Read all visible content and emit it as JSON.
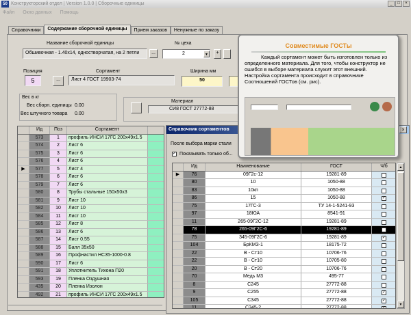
{
  "window": {
    "title": "Конструкторский отдел | Version 1.0.0 | Сборочные единицы",
    "menu": [
      "Файл",
      "Окно данных",
      "Помощь"
    ]
  },
  "tabs": [
    "Справочники",
    "Содержание сборочной единицы",
    "Прием заказов",
    "Ненужные по заказу"
  ],
  "form": {
    "assembly_label": "Название сборочной единицы",
    "assembly_value": "Обшивочная - 1.40x14, одностворчатая, на 2 петли",
    "shop_label": "№ цеха",
    "shop_value": "2",
    "position_label": "Позиция",
    "position_value": "5",
    "sortament_label": "Сортамент",
    "sortament_value": "Лист 4 ГОСТ 19903-74",
    "width_label": "Ширина мм",
    "width_value": "50",
    "weight_group": "Вес в кг",
    "weight_unit_label": "Вес сборн. единицы",
    "weight_unit_value": "0.00",
    "weight_piece_label": "Вес штучного товара",
    "weight_piece_value": "0.00",
    "material_label": "Материал",
    "material_value": "СИ8 ГОСТ 27772-88",
    "browse": "..."
  },
  "left_grid": {
    "headers": [
      "Ид",
      "Поз",
      "Сортамент"
    ],
    "rows": [
      [
        "573",
        "1",
        "профиль ИНСИ 17ГС 200x49x1.5"
      ],
      [
        "574",
        "2",
        "Лист 6"
      ],
      [
        "575",
        "3",
        "Лист 6"
      ],
      [
        "576",
        "4",
        "Лист 6"
      ],
      [
        "577",
        "5",
        "Лист 4"
      ],
      [
        "578",
        "6",
        "Лист 6"
      ],
      [
        "579",
        "7",
        "Лист 6"
      ],
      [
        "580",
        "8",
        "Трубы стальные 150x50x3"
      ],
      [
        "581",
        "9",
        "Лист 10"
      ],
      [
        "582",
        "10",
        "Лист 10"
      ],
      [
        "584",
        "11",
        "Лист 10"
      ],
      [
        "585",
        "12",
        "Лист 8"
      ],
      [
        "586",
        "13",
        "Лист 6"
      ],
      [
        "587",
        "14",
        "Лист 0.55"
      ],
      [
        "588",
        "15",
        "Балл 35x50"
      ],
      [
        "589",
        "16",
        "Профнастил НС35-1000-0.8"
      ],
      [
        "590",
        "17",
        "Лист 6"
      ],
      [
        "591",
        "18",
        "Уплотнитель Тихона П20"
      ],
      [
        "593",
        "19",
        "Пленка Оздушная"
      ],
      [
        "435",
        "20",
        "Пленка Изолон"
      ],
      [
        "492",
        "21",
        "профиль ИНСИ 17ГС 200x49x1.5"
      ]
    ],
    "current_row": 4
  },
  "ref_window": {
    "title": "Справочник сортаментов",
    "hint": "После выбора марки стали",
    "checkbox_label": "Показывать только об...",
    "checkbox_checked": true,
    "headers": [
      "Ид",
      "Наименование",
      "ГОСТ",
      "Ч/б"
    ],
    "rows": [
      [
        "76",
        "09Г2с-12",
        "19281-89",
        false
      ],
      [
        "80",
        "10",
        "1050-88",
        false
      ],
      [
        "83",
        "10кп",
        "1050-88",
        false
      ],
      [
        "86",
        "15",
        "1050-88",
        true
      ],
      [
        "75",
        "17ГС-3",
        "ТУ 14-1-5241-93",
        false
      ],
      [
        "97",
        "18ЮА",
        "8541-91",
        false
      ],
      [
        "11",
        "265-09Г2С-12",
        "19281-89",
        false
      ],
      [
        "78",
        "265-09Г2С-6",
        "19281-89",
        false
      ],
      [
        "75",
        "345-09Г2С-6",
        "19281-89",
        true
      ],
      [
        "104",
        "БрКМЗ-1",
        "18175-72",
        false
      ],
      [
        "22",
        "В - Ст10",
        "10706-76",
        false
      ],
      [
        "22",
        "В - Ст10",
        "10705-80",
        false
      ],
      [
        "20",
        "В - Ст20",
        "10706-76",
        false
      ],
      [
        "70",
        "Медь М3",
        "495-77",
        false
      ],
      [
        "8",
        "С245",
        "27772-88",
        false
      ],
      [
        "9",
        "С255",
        "27772-88",
        true
      ],
      [
        "105",
        "С345",
        "27772-88",
        true
      ],
      [
        "11",
        "С345-2",
        "27772-88",
        true
      ]
    ],
    "selected_row": 7
  },
  "popup": {
    "title": "Совместимые ГОСТы",
    "text": "Каждый сортамент может быть изготовлен только из определенного материала. Для того, чтобы конструктор не ошибся в выборе материала служит этот внешний. Настройка сортамента происходит в справочнике Соотношений ГОСТов (см. рис)."
  },
  "colors": {
    "pos": "#f1d9f4",
    "sort": "#d6f3d8",
    "teal": "#8ef0c0",
    "id": "#8c8c8c",
    "selected": "#000000",
    "title": "#0a246a",
    "popup_title": "#e08a1e"
  }
}
